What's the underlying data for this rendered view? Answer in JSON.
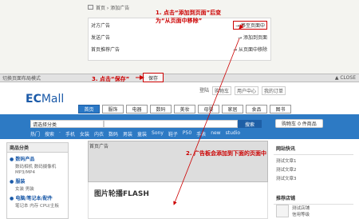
{
  "top": {
    "breadcrumb": "首页 › 添加广告",
    "widgets": [
      {
        "label": "对方广告",
        "action": "→ 移至页面中"
      },
      {
        "label": "发送广告",
        "action": "→ 添加到页面"
      },
      {
        "label": "首页推荐广告",
        "action": "→ 从页面中移除"
      }
    ],
    "note1": "1. 点击“添加到页面”后变为“从页面中移除”"
  },
  "midbar": {
    "left": "切换页面布局模式",
    "note3": "3. 点击“保存”",
    "save_label": "保存",
    "right": "▲ CLOSE"
  },
  "store": {
    "logo_ec": "EC",
    "logo_mall": "Mall",
    "toplinks": [
      "登陆",
      "购物车",
      "用户中心",
      "我的订单"
    ],
    "tabs": [
      "首页",
      "服饰",
      "电器",
      "数码",
      "美妆",
      "母婴",
      "家居",
      "食品",
      "图书"
    ],
    "search_select": "请选择分类",
    "search_button": "搜索",
    "cart_label": "购物车 0 件商品",
    "keywords": [
      "热门",
      "搜索",
      "·",
      "手机",
      "女装",
      "内衣",
      "数码",
      "男装",
      "童装",
      "Sony",
      "鞋子",
      "P50",
      "手表",
      "new",
      "studio"
    ],
    "category_title": "商品分类",
    "categories": [
      {
        "name": "● 数码产品",
        "subs": [
          "数码相机 数码摄像机",
          "MP3/MP4"
        ]
      },
      {
        "name": "● 服装",
        "subs": [
          "女装 男装"
        ]
      },
      {
        "name": "● 电脑/笔记本/配件",
        "subs": [
          "笔记本 内存 CPU/主板"
        ]
      }
    ],
    "ad_label": "首页广告",
    "flash_label": "图片轮播FLASH",
    "note2": "2. 广告板会添加到下面的页面中",
    "news_title": "网站快讯",
    "news": [
      "测试文章1",
      "测试文章2",
      "测试文章3"
    ],
    "rec_title": "推荐店铺",
    "rec_lines": [
      "测试店铺",
      "信用等级"
    ]
  },
  "colors": {
    "annotation": "#cc0000",
    "brand": "#1b5aa8",
    "navbar": "#2d7ac4"
  }
}
